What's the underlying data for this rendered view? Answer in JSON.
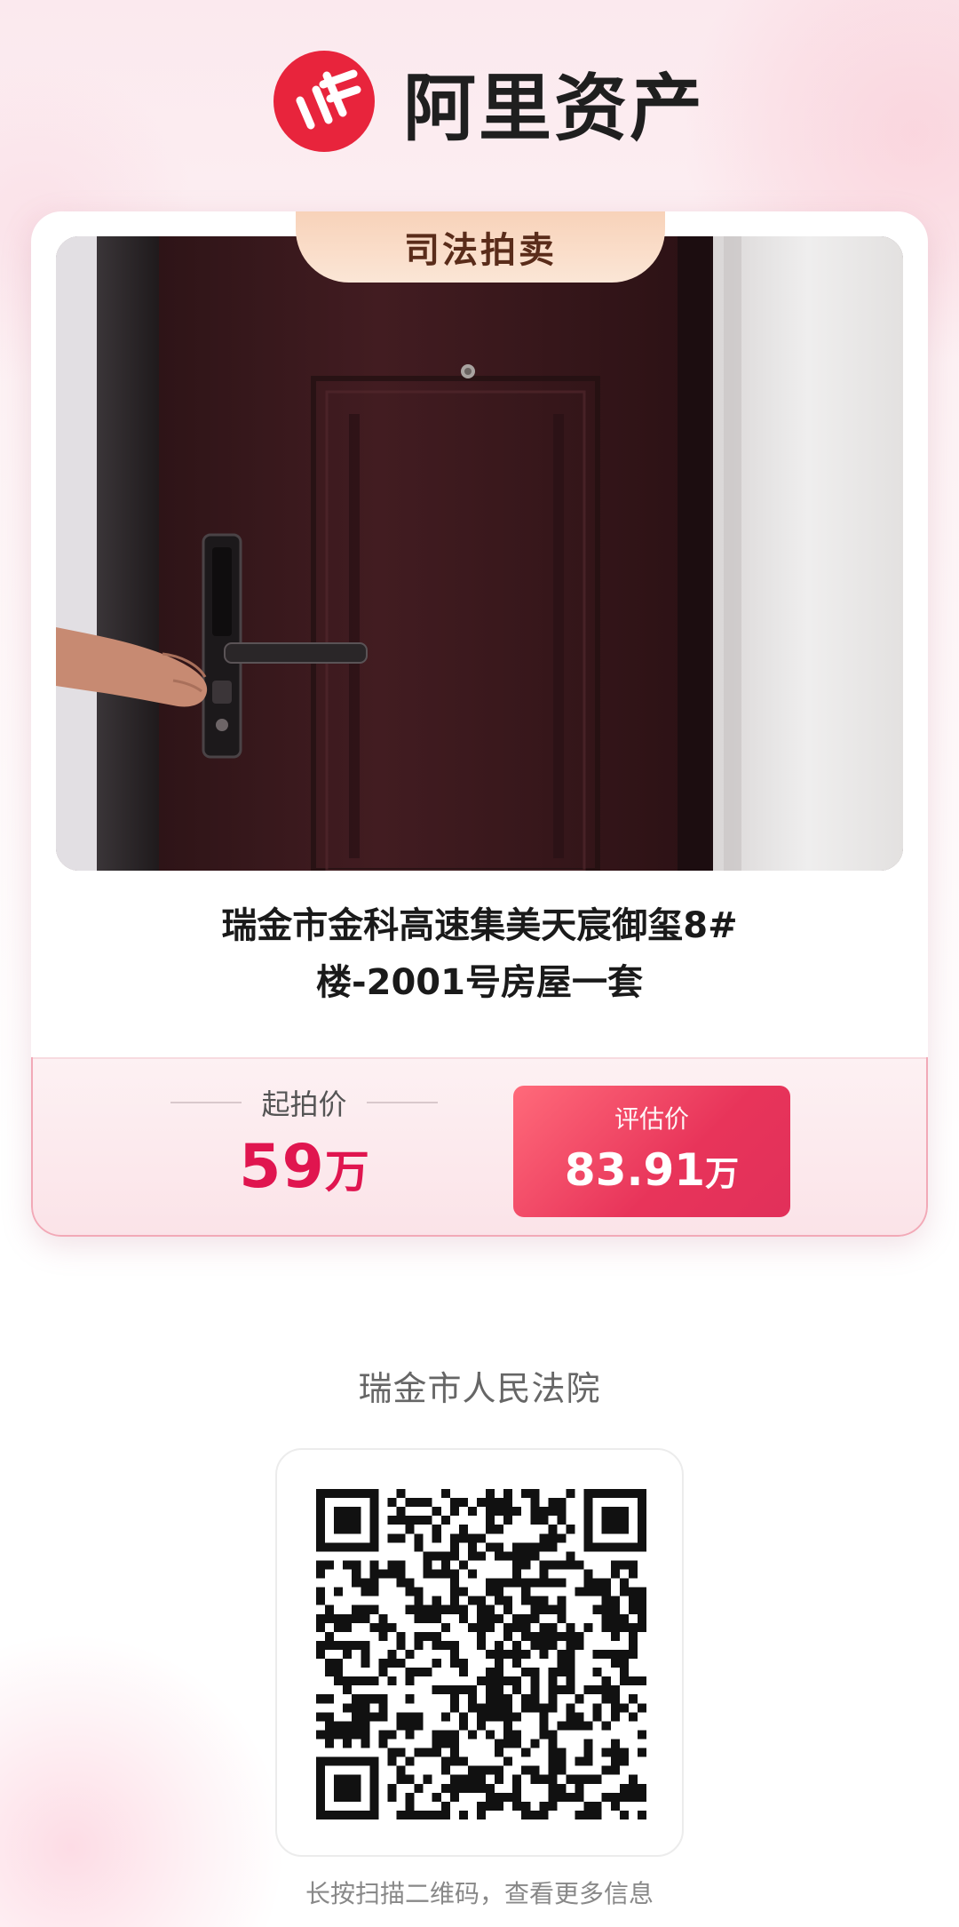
{
  "brand": {
    "name": "阿里资产",
    "logo_icon": "ali-asset-logo-icon",
    "brand_color": "#e8243c"
  },
  "card": {
    "tag": "司法拍卖",
    "photo_icon": "door-photo",
    "title_line1": "瑞金市金科高速集美天宸御玺8#",
    "title_line2": "楼-2001号房屋一套",
    "start_price_label": "起拍价",
    "start_price_value": "59",
    "start_price_unit": "万",
    "estimate_label": "评估价",
    "estimate_value": "83.91",
    "estimate_unit": "万",
    "accent_color": "#e0154f"
  },
  "court": {
    "name": "瑞金市人民法院"
  },
  "qr": {
    "icon": "qr-code-icon",
    "hint": "长按扫描二维码，查看更多信息"
  }
}
